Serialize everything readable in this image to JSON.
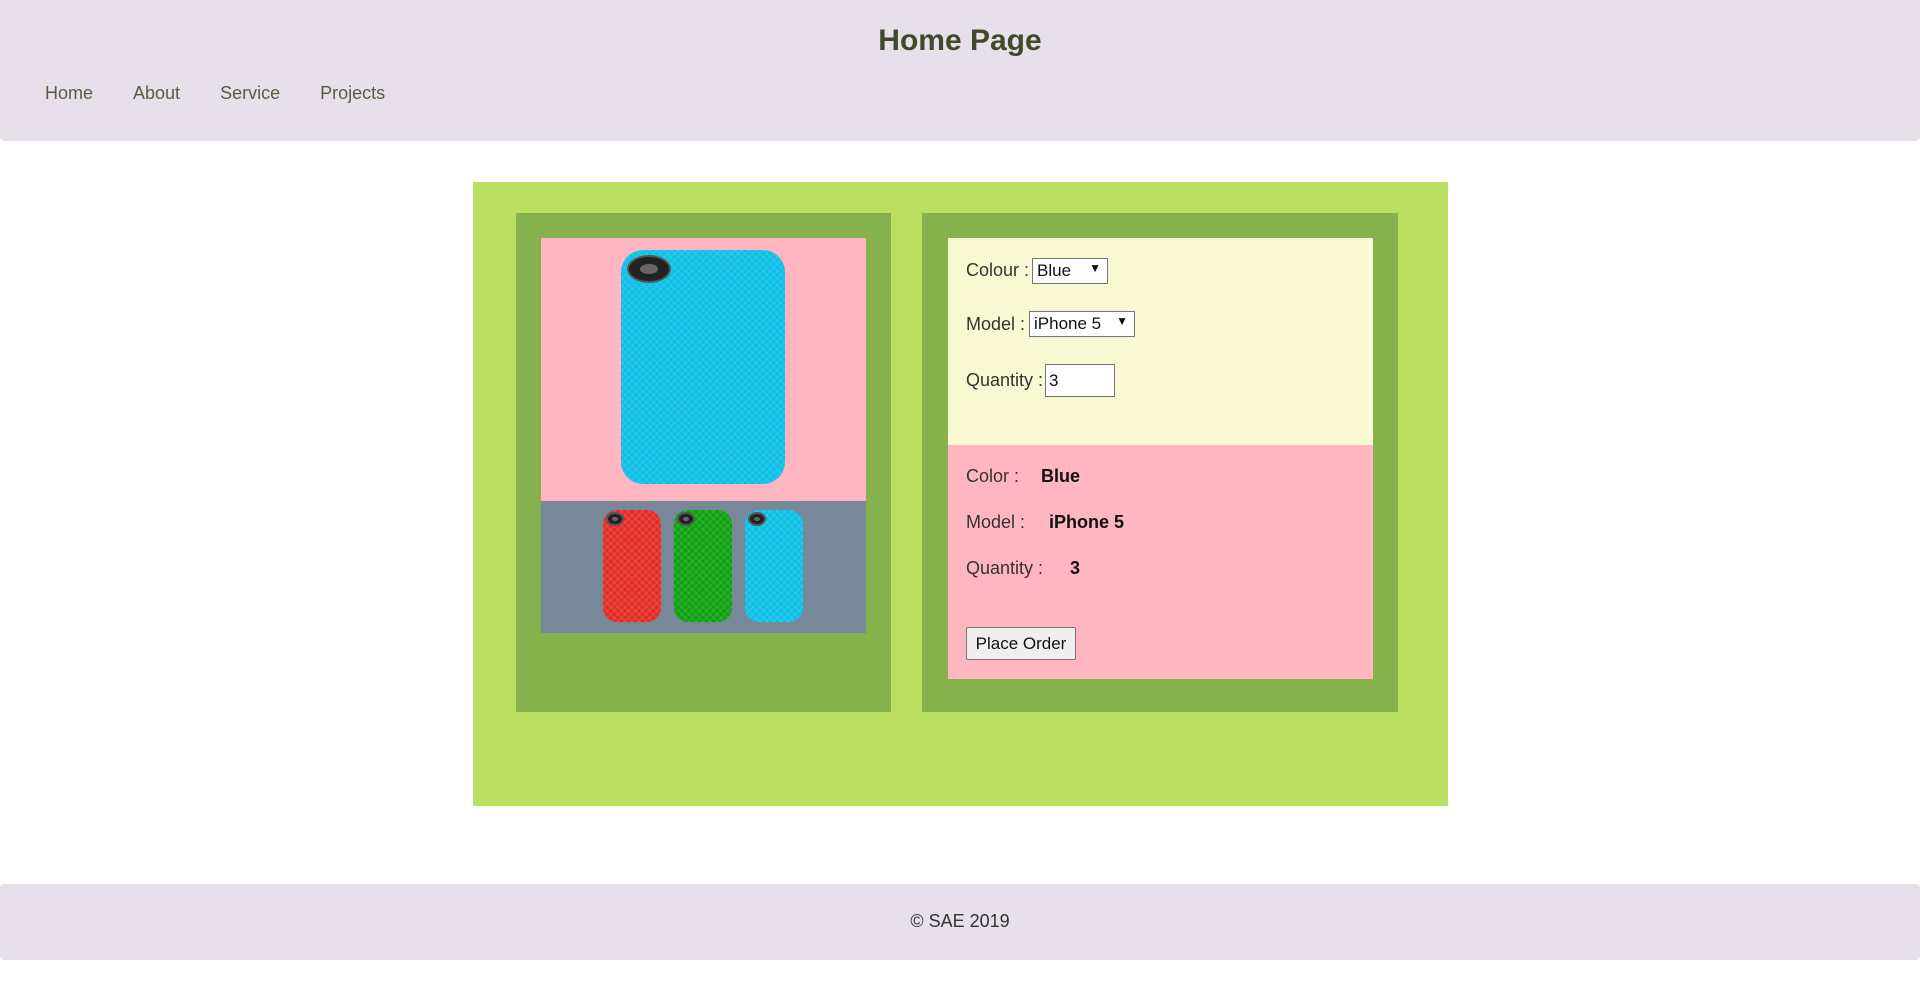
{
  "header": {
    "title": "Home Page",
    "nav": [
      "Home",
      "About",
      "Service",
      "Projects"
    ]
  },
  "product": {
    "main_image_icon": "phone-case-image",
    "thumbnails": [
      {
        "color_name": "red",
        "color": "#e32b24"
      },
      {
        "color_name": "green",
        "color": "#0ea00e"
      },
      {
        "color_name": "blue",
        "color": "#0bbfe6"
      }
    ],
    "main_color": "#0bbfe6"
  },
  "form": {
    "colour_label": "Colour :",
    "colour_value": "Blue",
    "model_label": "Model :",
    "model_value": "iPhone 5",
    "quantity_label": "Quantity :",
    "quantity_value": "3"
  },
  "summary": {
    "color_label": "Color :",
    "color_value": "Blue",
    "model_label": "Model :",
    "model_value": "iPhone 5",
    "quantity_label": "Quantity :",
    "quantity_value": "3",
    "button_label": "Place Order"
  },
  "footer": {
    "text": "© SAE 2019"
  },
  "colors": {
    "header_bg": "#e7dfea",
    "outer_bg": "#badf63",
    "panel_bg": "#85b24c",
    "image_bg": "#ffb6c1",
    "thumb_bg": "#778899",
    "form_bg": "#f8f9d2",
    "summary_bg": "#ffb6c1"
  }
}
